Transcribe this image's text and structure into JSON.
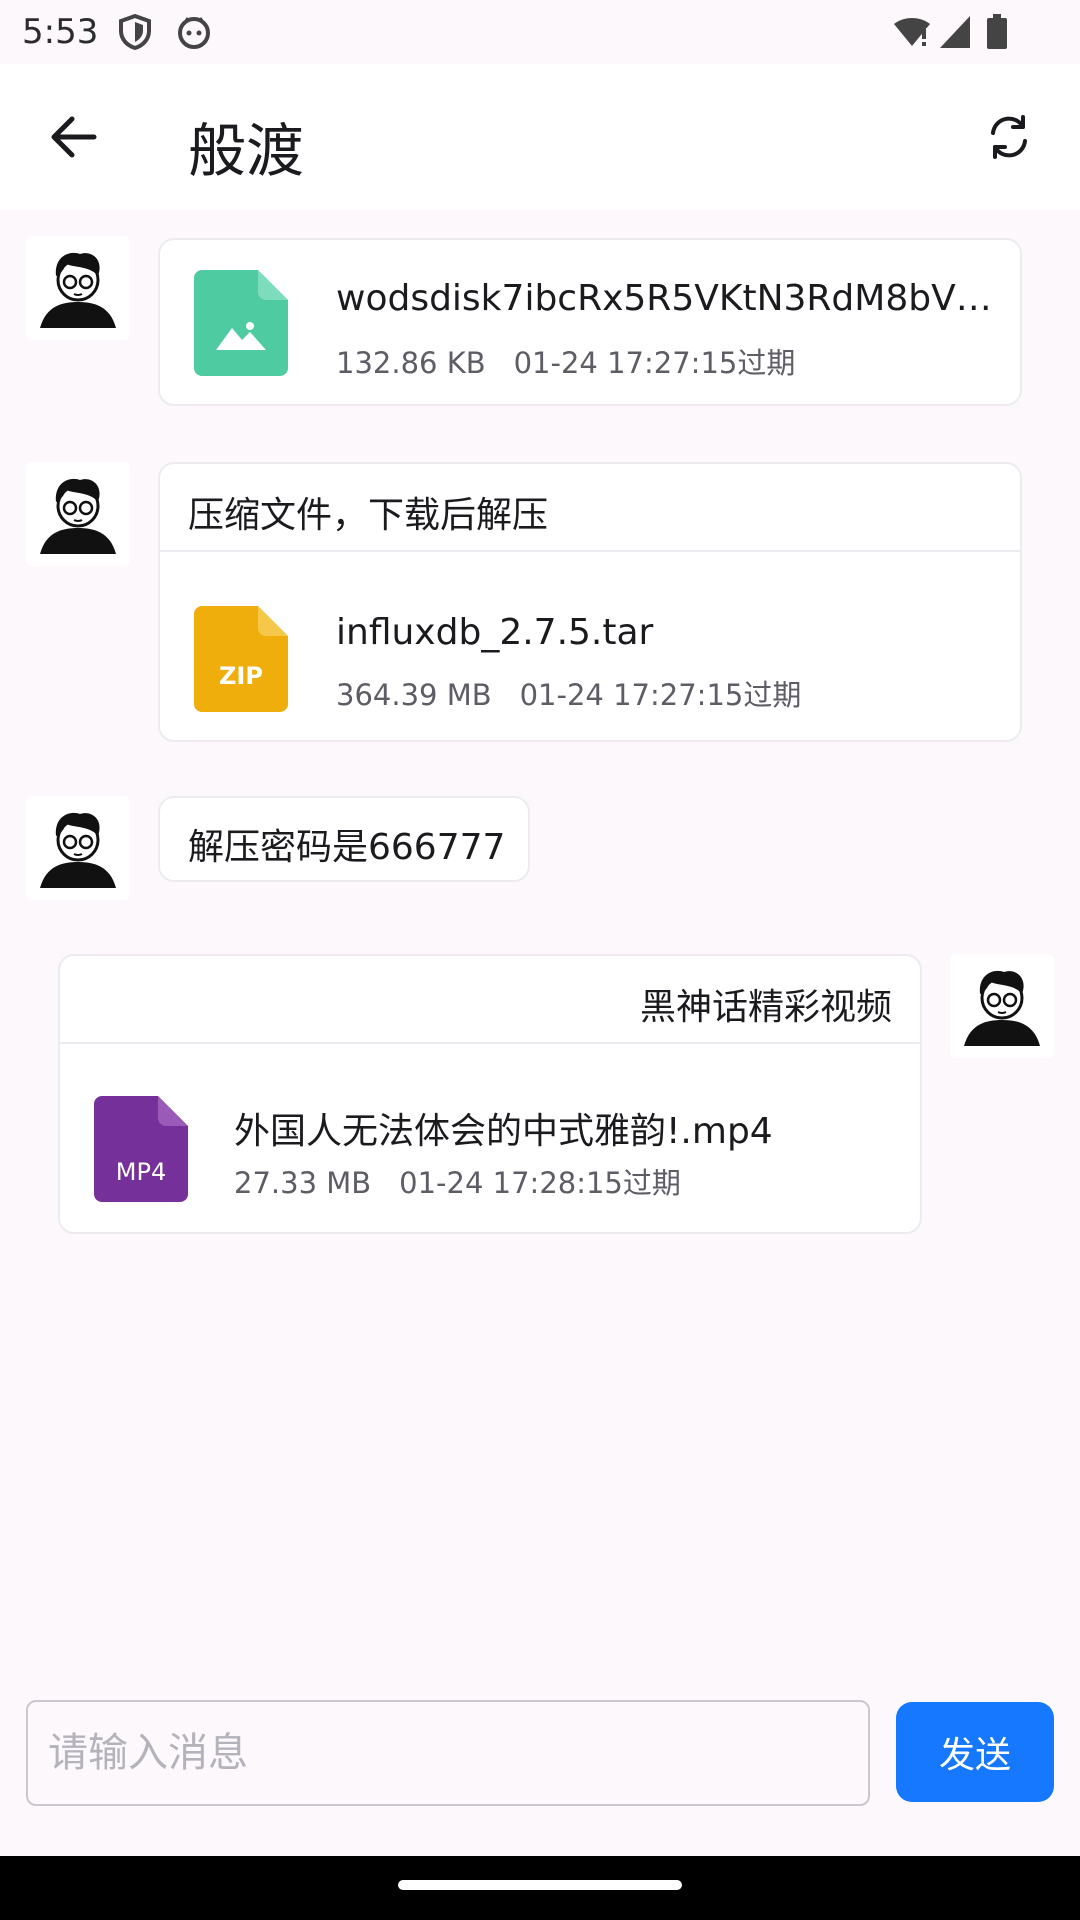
{
  "status_bar": {
    "time": "5:53",
    "icons_left": [
      "shield-icon",
      "robot-face-icon"
    ],
    "icons_right": [
      "wifi-alert-icon",
      "cellular-signal-icon",
      "battery-icon"
    ]
  },
  "app_bar": {
    "title": "般渡",
    "back_icon": "arrow-left-icon",
    "refresh_icon": "refresh-icon"
  },
  "messages": [
    {
      "side": "left",
      "type": "file",
      "file": {
        "icon": "image-file-icon",
        "icon_color": "#4ecba0",
        "name": "wodsdisk7ibcRx5R5VKtN3RdM8bV…",
        "size": "132.86 KB",
        "expiry": "01-24 17:27:15过期"
      }
    },
    {
      "side": "left",
      "type": "text_file",
      "text": "压缩文件，下载后解压",
      "file": {
        "icon": "zip-file-icon",
        "icon_label": "ZIP",
        "icon_color": "#f0ae0c",
        "name": "influxdb_2.7.5.tar",
        "size": "364.39 MB",
        "expiry": "01-24 17:27:15过期"
      }
    },
    {
      "side": "left",
      "type": "text",
      "text": "解压密码是666777"
    },
    {
      "side": "right",
      "type": "text_file",
      "text": "黑神话精彩视频",
      "file": {
        "icon": "video-file-icon",
        "icon_label": "MP4",
        "icon_color": "#76309a",
        "name": "外国人无法体会的中式雅韵!.mp4",
        "size": "27.33 MB",
        "expiry": "01-24 17:28:15过期"
      }
    }
  ],
  "input_bar": {
    "placeholder": "请输入消息",
    "value": "",
    "send_label": "发送",
    "send_color": "#1677ff"
  }
}
